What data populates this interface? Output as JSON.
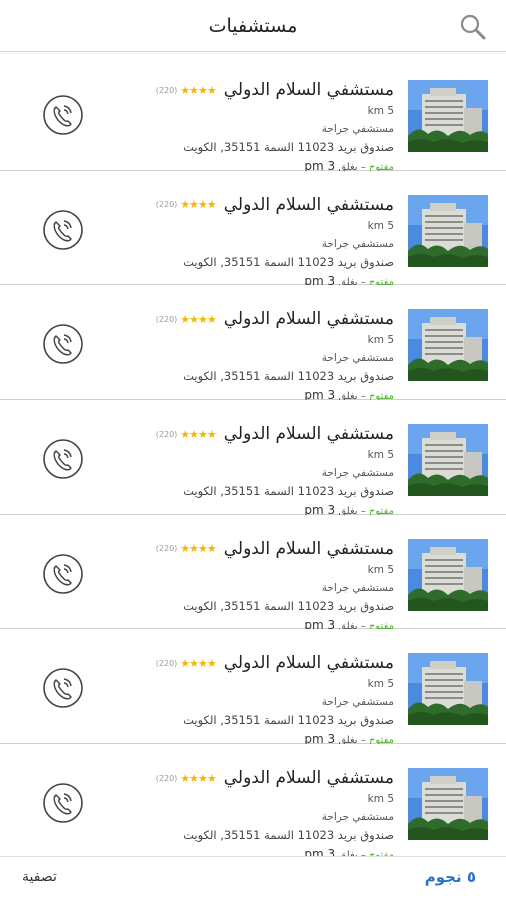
{
  "header": {
    "title": "مستشفيات",
    "search_icon": "search-icon"
  },
  "item": {
    "name": "مستشفي السلام الدولي",
    "stars": "★★★★",
    "reviews": "(220)",
    "distance": "km 5",
    "category": "مستشفي جراحة",
    "address": "صندوق بريد 11023 السمة 35151, الكويت",
    "open": "مفتوح",
    "sep": " – يغلق ",
    "close_time": "3 pm",
    "call_icon": "phone-call-icon"
  },
  "items": [
    {
      "name": "مستشفي السلام الدولي"
    },
    {
      "name": "مستشفي السلام الدولي"
    },
    {
      "name": "مستشفي السلام الدولي"
    },
    {
      "name": "مستشفي السلام الدولي"
    },
    {
      "name": "مستشفي السلام الدولي"
    },
    {
      "name": "مستشفي السلام الدولي"
    },
    {
      "name": "مستشفي السلام الدولي"
    }
  ],
  "footer": {
    "filter_label": "تصفية",
    "stars_label": "٥ نجوم"
  },
  "colors": {
    "stars": "#f2b705",
    "open": "#4caf2a",
    "accent": "#2b73c9"
  }
}
